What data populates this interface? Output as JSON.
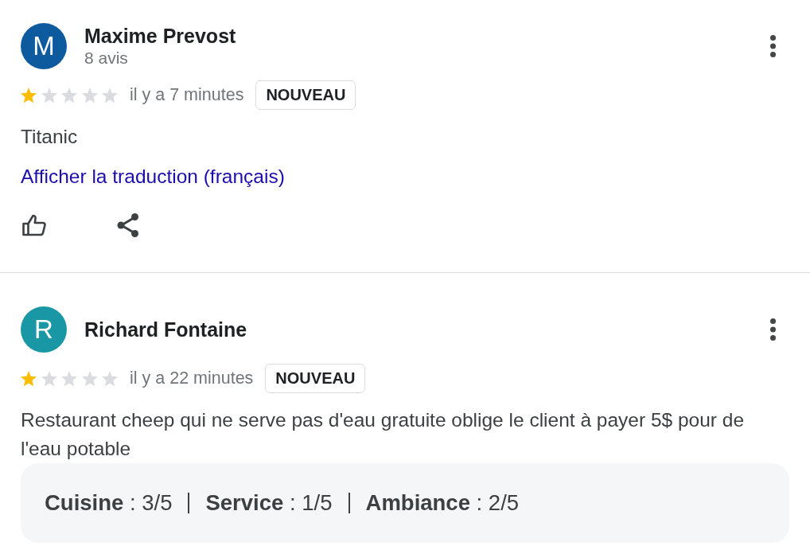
{
  "reviews": [
    {
      "author": "Maxime Prevost",
      "review_count": "8 avis",
      "avatar": {
        "initial": "M",
        "color": "#0e5a9f"
      },
      "stars": 1,
      "time": "il y a 7 minutes",
      "badge": "NOUVEAU",
      "text": "Titanic",
      "translate_link": "Afficher la traduction (français)",
      "actions": [
        {
          "kind": "like"
        },
        {
          "kind": "share"
        }
      ]
    },
    {
      "author": "Richard Fontaine",
      "avatar": {
        "initial": "R",
        "color": "#1a97a5"
      },
      "stars": 1,
      "time": "il y a 22 minutes",
      "badge": "NOUVEAU",
      "text": "Restaurant cheep qui ne serve pas d'eau gratuite oblige le client à payer 5$ pour de l'eau potable",
      "sub_ratings": [
        "**Cuisine** : 3/5",
        "**Service** : 1/5",
        "**Ambiance** : 2/5"
      ]
    }
  ]
}
